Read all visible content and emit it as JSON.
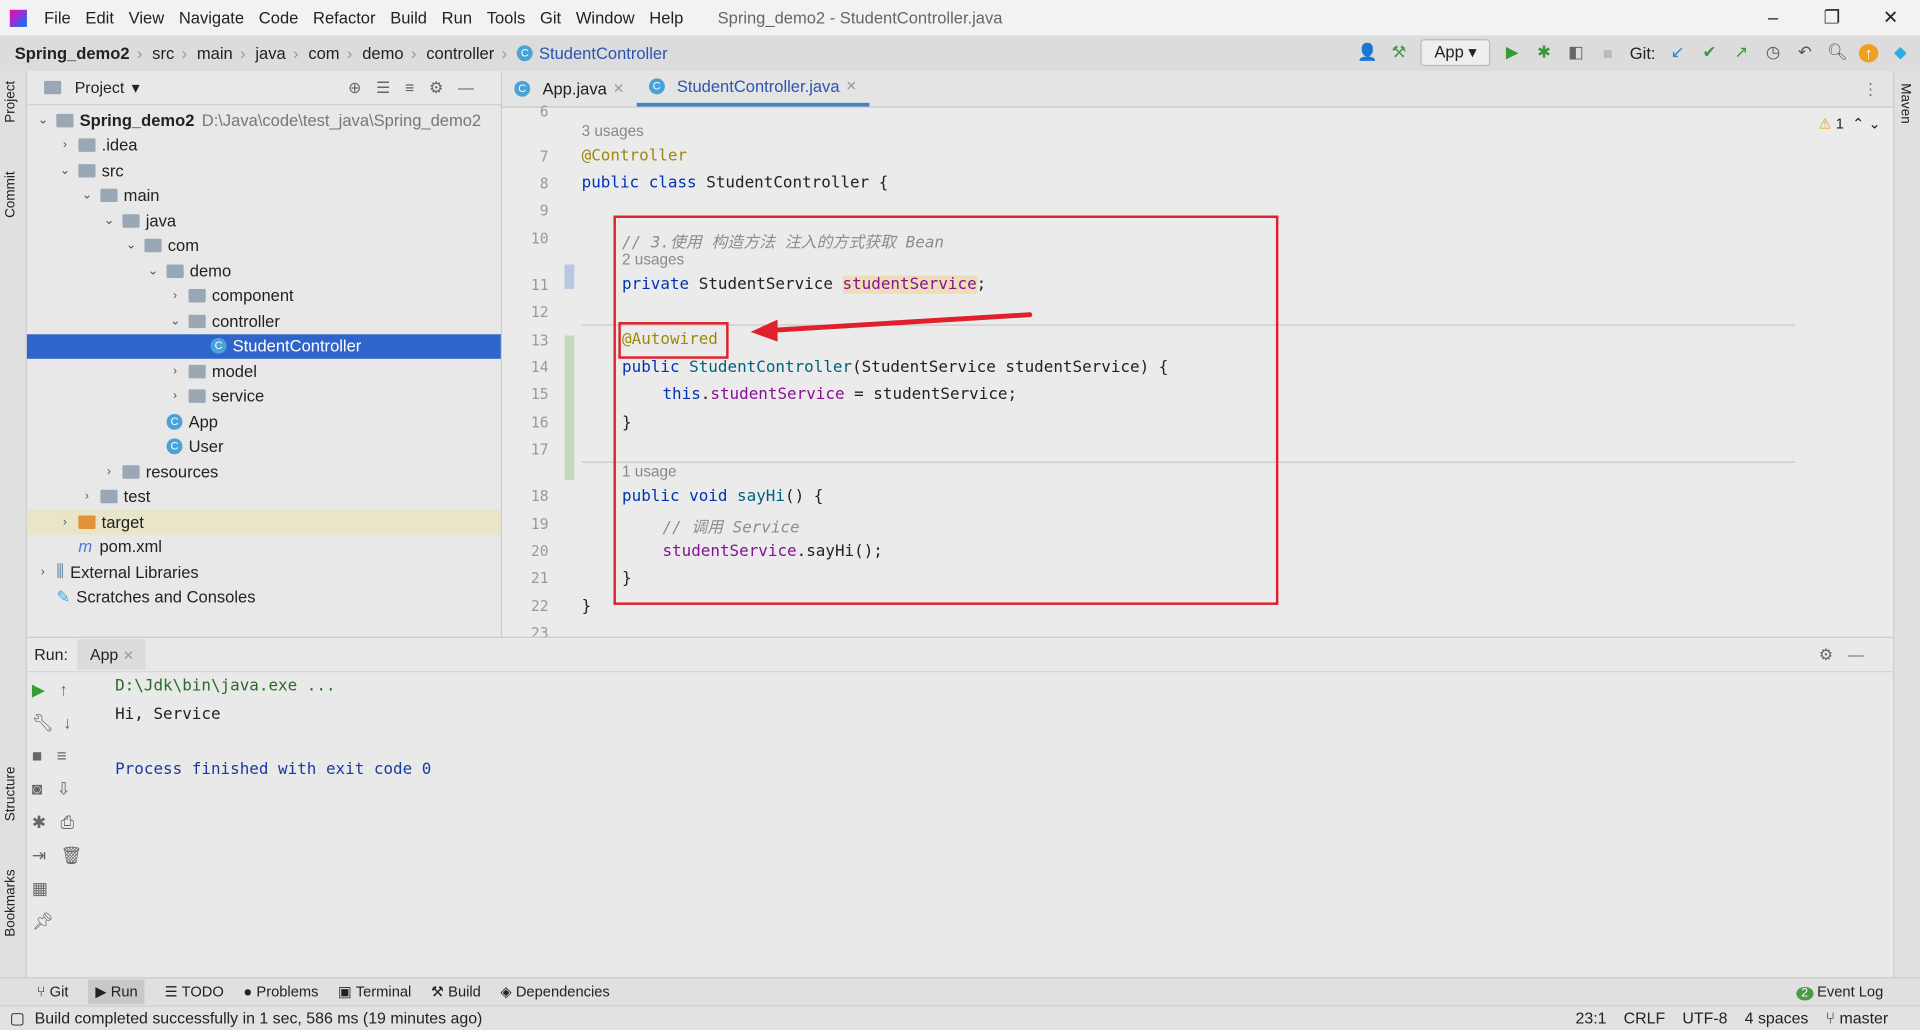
{
  "window": {
    "title": "Spring_demo2 - StudentController.java",
    "controls": [
      "–",
      "❐",
      "✕"
    ]
  },
  "menu": [
    "File",
    "Edit",
    "View",
    "Navigate",
    "Code",
    "Refactor",
    "Build",
    "Run",
    "Tools",
    "Git",
    "Window",
    "Help"
  ],
  "breadcrumb": [
    "Spring_demo2",
    "src",
    "main",
    "java",
    "com",
    "demo",
    "controller",
    "StudentController"
  ],
  "toolbar": {
    "run_config": "App",
    "git_label": "Git:"
  },
  "side_tabs": {
    "left": [
      "Project",
      "Commit",
      "Structure",
      "Bookmarks"
    ],
    "right": [
      "Maven"
    ]
  },
  "project": {
    "title": "Project",
    "root_name": "Spring_demo2",
    "root_path": "D:\\Java\\code\\test_java\\Spring_demo2",
    "items": [
      {
        "label": ".idea",
        "depth": 1,
        "type": "folder",
        "arrow": "›"
      },
      {
        "label": "src",
        "depth": 1,
        "type": "folder",
        "arrow": "⌄"
      },
      {
        "label": "main",
        "depth": 2,
        "type": "folder",
        "arrow": "⌄"
      },
      {
        "label": "java",
        "depth": 3,
        "type": "folder",
        "arrow": "⌄"
      },
      {
        "label": "com",
        "depth": 4,
        "type": "folder",
        "arrow": "⌄"
      },
      {
        "label": "demo",
        "depth": 5,
        "type": "folder",
        "arrow": "⌄"
      },
      {
        "label": "component",
        "depth": 6,
        "type": "folder",
        "arrow": "›"
      },
      {
        "label": "controller",
        "depth": 6,
        "type": "folder",
        "arrow": "⌄"
      },
      {
        "label": "StudentController",
        "depth": 7,
        "type": "class",
        "arrow": "",
        "selected": true
      },
      {
        "label": "model",
        "depth": 6,
        "type": "folder",
        "arrow": "›"
      },
      {
        "label": "service",
        "depth": 6,
        "type": "folder",
        "arrow": "›"
      },
      {
        "label": "App",
        "depth": 5,
        "type": "class",
        "arrow": ""
      },
      {
        "label": "User",
        "depth": 5,
        "type": "class",
        "arrow": ""
      },
      {
        "label": "resources",
        "depth": 3,
        "type": "folder",
        "arrow": "›"
      },
      {
        "label": "test",
        "depth": 2,
        "type": "folder",
        "arrow": "›"
      },
      {
        "label": "target",
        "depth": 1,
        "type": "folder-orange",
        "arrow": "›",
        "highlight": true
      },
      {
        "label": "pom.xml",
        "depth": 1,
        "type": "maven",
        "arrow": ""
      },
      {
        "label": "External Libraries",
        "depth": 0,
        "type": "lib",
        "arrow": "›"
      },
      {
        "label": "Scratches and Consoles",
        "depth": 0,
        "type": "scratch",
        "arrow": ""
      }
    ]
  },
  "editor": {
    "tabs": [
      {
        "label": "App.java",
        "active": false
      },
      {
        "label": "StudentController.java",
        "active": true
      }
    ],
    "warnings": "1",
    "line_numbers": [
      "6",
      "7",
      "8",
      "9",
      "10",
      "11",
      "12",
      "13",
      "14",
      "15",
      "16",
      "17",
      "18",
      "19",
      "20",
      "21",
      "22",
      "23"
    ],
    "hints": {
      "h1": "3 usages",
      "h2": "2 usages",
      "h3": "1 usage"
    },
    "code": {
      "l7": "@Controller",
      "l8a": "public class ",
      "l8b": "StudentController {",
      "l10": "// 3.使用 构造方法 注入的方式获取 Bean",
      "l11a": "private ",
      "l11b": "StudentService ",
      "l11c": "studentService",
      "l11d": ";",
      "l13": "@Autowired",
      "l14a": "public ",
      "l14b": "StudentController",
      "l14c": "(StudentService studentService) {",
      "l15a": "this",
      "l15b": ".",
      "l15c": "studentService",
      "l15d": " = studentService;",
      "l16": "}",
      "l18a": "public void ",
      "l18b": "sayHi",
      "l18c": "() {",
      "l19": "// 调用 Service",
      "l20a": "studentService",
      "l20b": ".sayHi();",
      "l21": "}",
      "l22": "}"
    }
  },
  "run": {
    "label": "Run:",
    "tab": "App",
    "output": [
      "D:\\Jdk\\bin\\java.exe ...",
      "Hi, Service",
      "",
      "Process finished with exit code 0"
    ]
  },
  "bottom_tools": [
    "Git",
    "Run",
    "TODO",
    "Problems",
    "Terminal",
    "Build",
    "Dependencies"
  ],
  "event_log": {
    "label": "Event Log",
    "count": "2"
  },
  "status": {
    "message": "Build completed successfully in 1 sec, 586 ms (19 minutes ago)",
    "position": "23:1",
    "line_sep": "CRLF",
    "encoding": "UTF-8",
    "indent": "4 spaces",
    "branch": "master"
  },
  "colors": {
    "accent": "#2f65ca",
    "annotation_box": "#e0202a"
  }
}
